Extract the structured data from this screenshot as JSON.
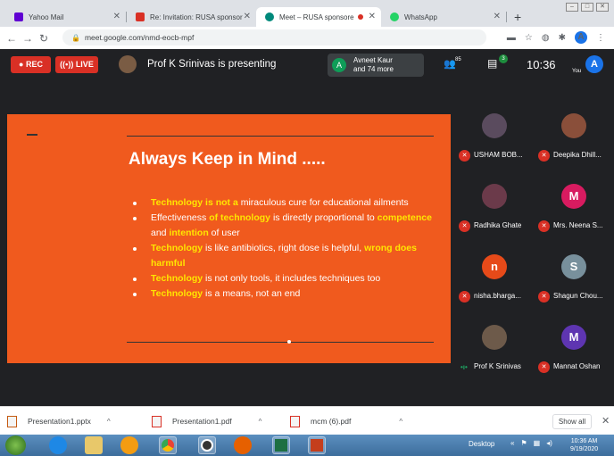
{
  "browser": {
    "tabs": [
      {
        "label": "Yahoo Mail",
        "color": "#6001d2"
      },
      {
        "label": "Re: Invitation: RUSA sponsor",
        "color": "#d93025"
      },
      {
        "label": "Meet – RUSA sponsore",
        "color": "#00897b",
        "recording_dot": "#d93025"
      },
      {
        "label": "WhatsApp",
        "color": "#25d366"
      }
    ],
    "url": "meet.google.com/nmd-eocb-mpf",
    "profile_initial": "A"
  },
  "meet": {
    "rec_label": "REC",
    "live_label": "LIVE",
    "presenting_text": "Prof K Srinivas is presenting",
    "participants_chip": {
      "initial": "A",
      "line1": "Avneet Kaur",
      "line2": "and 74 more"
    },
    "people_count": "85",
    "chat_badge": "3",
    "time": "10:36",
    "you_initial": "A",
    "you_label": "You"
  },
  "slide": {
    "title": "Always Keep in Mind .....",
    "bullets": [
      [
        {
          "t": "Technology is not a",
          "h": true
        },
        {
          "t": " miraculous cure for educational ailments",
          "h": false
        }
      ],
      [
        {
          "t": "Effectiveness ",
          "h": false
        },
        {
          "t": "of technology",
          "h": true
        },
        {
          "t": " is directly proportional to ",
          "h": false
        },
        {
          "t": "competence",
          "h": true
        },
        {
          "t": " and ",
          "h": false
        },
        {
          "t": "intention",
          "h": true
        },
        {
          "t": " of user",
          "h": false
        }
      ],
      [
        {
          "t": "Technology",
          "h": true
        },
        {
          "t": " is like antibiotics, right dose is helpful, ",
          "h": false
        },
        {
          "t": "wrong does harmful",
          "h": true
        }
      ],
      [
        {
          "t": "Technology",
          "h": true
        },
        {
          "t": " is not only tools, it includes techniques too",
          "h": false
        }
      ],
      [
        {
          "t": "Technology",
          "h": true
        },
        {
          "t": " is a means, not an end",
          "h": false
        }
      ]
    ]
  },
  "participants": [
    {
      "name": "USHAM BOB...",
      "initial": "",
      "color": "#5a4b5e",
      "muted": true
    },
    {
      "name": "Deepika Dhill...",
      "initial": "",
      "color": "#8a4f3a",
      "muted": true
    },
    {
      "name": "Radhika Ghate",
      "initial": "",
      "color": "#6b3a4a",
      "muted": true
    },
    {
      "name": "Mrs. Neena S...",
      "initial": "M",
      "color": "#d81b60",
      "muted": true
    },
    {
      "name": "nisha.bharga...",
      "initial": "n",
      "color": "#e64a19",
      "muted": true
    },
    {
      "name": "Shagun Chou...",
      "initial": "S",
      "color": "#78909c",
      "muted": true
    },
    {
      "name": "Prof K Srinivas",
      "initial": "",
      "color": "#6d5a4a",
      "muted": false
    },
    {
      "name": "Mannat Oshan",
      "initial": "M",
      "color": "#5e35b1",
      "muted": true
    }
  ],
  "downloads": {
    "items": [
      "Presentation1.pptx",
      "Presentation1.pdf",
      "mcm (6).pdf"
    ],
    "show_all": "Show all"
  },
  "taskbar": {
    "desktop_label": "Desktop",
    "time": "10:36 AM",
    "date": "9/19/2020"
  }
}
